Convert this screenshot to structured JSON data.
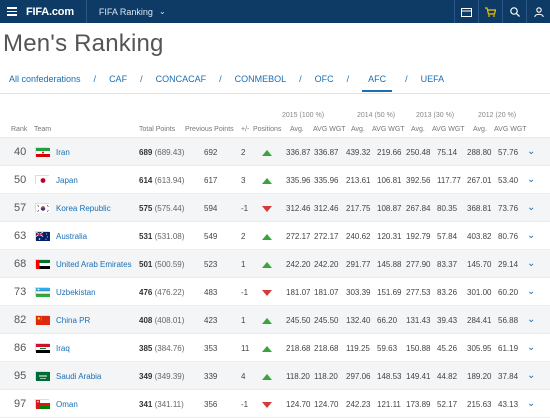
{
  "header": {
    "logo": "FIFA.com",
    "section": "FIFA Ranking",
    "icons": [
      "menu-icon",
      "calendar-icon",
      "cart-icon",
      "search-icon",
      "user-icon"
    ]
  },
  "page_title": "Men's Ranking",
  "tabs": [
    {
      "label": "All confederations",
      "active": false
    },
    {
      "label": "CAF",
      "active": false
    },
    {
      "label": "CONCACAF",
      "active": false
    },
    {
      "label": "CONMEBOL",
      "active": false
    },
    {
      "label": "OFC",
      "active": false
    },
    {
      "label": "AFC",
      "active": true
    },
    {
      "label": "UEFA",
      "active": false
    }
  ],
  "table": {
    "year_headers": [
      "2015 (100 %)",
      "2014 (50 %)",
      "2013 (30 %)",
      "2012 (20 %)"
    ],
    "columns": [
      "Rank",
      "Team",
      "Total Points",
      "Previous Points",
      "+/-",
      "Positions",
      "Avg.",
      "AVG WGT",
      "Avg.",
      "AVG WGT",
      "Avg.",
      "AVG WGT",
      "Avg.",
      "AVG WGT"
    ],
    "rows": [
      {
        "rank": "40",
        "team": "Iran",
        "flag": "iran",
        "points": "689",
        "points_detail": "(689.43)",
        "prev": "692",
        "change": "2",
        "dir": "up",
        "v": [
          "336.87",
          "336.87",
          "439.32",
          "219.66",
          "250.48",
          "75.14",
          "288.80",
          "57.76"
        ]
      },
      {
        "rank": "50",
        "team": "Japan",
        "flag": "japan",
        "points": "614",
        "points_detail": "(613.94)",
        "prev": "617",
        "change": "3",
        "dir": "up",
        "v": [
          "335.96",
          "335.96",
          "213.61",
          "106.81",
          "392.56",
          "117.77",
          "267.01",
          "53.40"
        ]
      },
      {
        "rank": "57",
        "team": "Korea Republic",
        "flag": "korea",
        "points": "575",
        "points_detail": "(575.44)",
        "prev": "594",
        "change": "-1",
        "dir": "down",
        "v": [
          "312.46",
          "312.46",
          "217.75",
          "108.87",
          "267.84",
          "80.35",
          "368.81",
          "73.76"
        ]
      },
      {
        "rank": "63",
        "team": "Australia",
        "flag": "australia",
        "points": "531",
        "points_detail": "(531.08)",
        "prev": "549",
        "change": "2",
        "dir": "up",
        "v": [
          "272.17",
          "272.17",
          "240.62",
          "120.31",
          "192.79",
          "57.84",
          "403.82",
          "80.76"
        ]
      },
      {
        "rank": "68",
        "team": "United Arab Emirates",
        "flag": "uae",
        "points": "501",
        "points_detail": "(500.59)",
        "prev": "523",
        "change": "1",
        "dir": "up",
        "v": [
          "242.20",
          "242.20",
          "291.77",
          "145.88",
          "277.90",
          "83.37",
          "145.70",
          "29.14"
        ]
      },
      {
        "rank": "73",
        "team": "Uzbekistan",
        "flag": "uzbekistan",
        "points": "476",
        "points_detail": "(476.22)",
        "prev": "483",
        "change": "-1",
        "dir": "down",
        "v": [
          "181.07",
          "181.07",
          "303.39",
          "151.69",
          "277.53",
          "83.26",
          "301.00",
          "60.20"
        ]
      },
      {
        "rank": "82",
        "team": "China PR",
        "flag": "china",
        "points": "408",
        "points_detail": "(408.01)",
        "prev": "423",
        "change": "1",
        "dir": "up",
        "v": [
          "245.50",
          "245.50",
          "132.40",
          "66.20",
          "131.43",
          "39.43",
          "284.41",
          "56.88"
        ]
      },
      {
        "rank": "86",
        "team": "Iraq",
        "flag": "iraq",
        "points": "385",
        "points_detail": "(384.76)",
        "prev": "353",
        "change": "11",
        "dir": "up",
        "v": [
          "218.68",
          "218.68",
          "119.25",
          "59.63",
          "150.88",
          "45.26",
          "305.95",
          "61.19"
        ]
      },
      {
        "rank": "95",
        "team": "Saudi Arabia",
        "flag": "saudi",
        "points": "349",
        "points_detail": "(349.39)",
        "prev": "339",
        "change": "4",
        "dir": "up",
        "v": [
          "118.20",
          "118.20",
          "297.06",
          "148.53",
          "149.41",
          "44.82",
          "189.20",
          "37.84"
        ]
      },
      {
        "rank": "97",
        "team": "Oman",
        "flag": "oman",
        "points": "341",
        "points_detail": "(341.11)",
        "prev": "356",
        "change": "-1",
        "dir": "down",
        "v": [
          "124.70",
          "124.70",
          "242.23",
          "121.11",
          "173.89",
          "52.17",
          "215.63",
          "43.13"
        ]
      }
    ]
  }
}
